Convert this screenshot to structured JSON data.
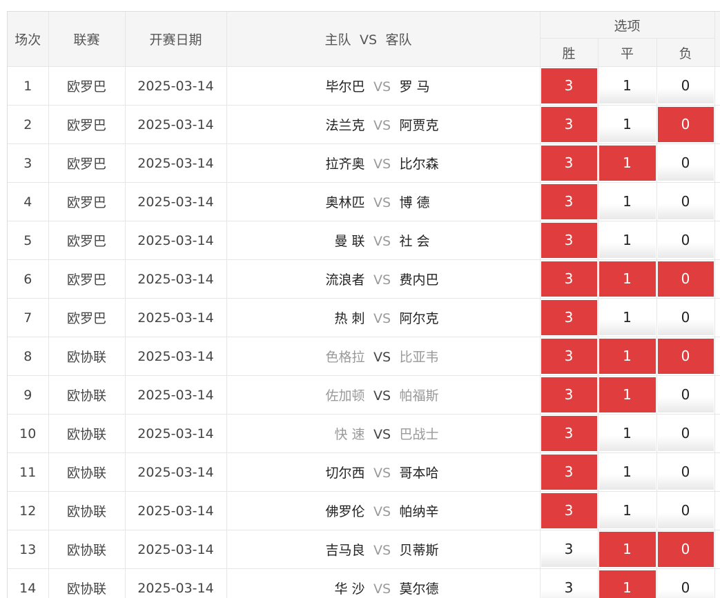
{
  "headers": {
    "round": "场次",
    "league": "联赛",
    "date": "开赛日期",
    "home": "主队",
    "vs": "VS",
    "away": "客队",
    "options": "选项",
    "win": "胜",
    "draw": "平",
    "loss": "负"
  },
  "colors": {
    "selected": "#e03e3e",
    "vs": "#999999"
  },
  "rows": [
    {
      "no": "1",
      "league": "欧罗巴",
      "date": "2025-03-14",
      "home": "毕尔巴",
      "vs": "VS",
      "away": "罗 马",
      "gray": false,
      "win": "3",
      "draw": "1",
      "loss": "0",
      "sel": [
        true,
        false,
        false
      ]
    },
    {
      "no": "2",
      "league": "欧罗巴",
      "date": "2025-03-14",
      "home": "法兰克",
      "vs": "VS",
      "away": "阿贾克",
      "gray": false,
      "win": "3",
      "draw": "1",
      "loss": "0",
      "sel": [
        true,
        false,
        true
      ]
    },
    {
      "no": "3",
      "league": "欧罗巴",
      "date": "2025-03-14",
      "home": "拉齐奥",
      "vs": "VS",
      "away": "比尔森",
      "gray": false,
      "win": "3",
      "draw": "1",
      "loss": "0",
      "sel": [
        true,
        true,
        false
      ]
    },
    {
      "no": "4",
      "league": "欧罗巴",
      "date": "2025-03-14",
      "home": "奥林匹",
      "vs": "VS",
      "away": "博 德",
      "gray": false,
      "win": "3",
      "draw": "1",
      "loss": "0",
      "sel": [
        true,
        false,
        false
      ]
    },
    {
      "no": "5",
      "league": "欧罗巴",
      "date": "2025-03-14",
      "home": "曼 联",
      "vs": "VS",
      "away": "社 会",
      "gray": false,
      "win": "3",
      "draw": "1",
      "loss": "0",
      "sel": [
        true,
        false,
        false
      ]
    },
    {
      "no": "6",
      "league": "欧罗巴",
      "date": "2025-03-14",
      "home": "流浪者",
      "vs": "VS",
      "away": "费内巴",
      "gray": false,
      "win": "3",
      "draw": "1",
      "loss": "0",
      "sel": [
        true,
        true,
        true
      ]
    },
    {
      "no": "7",
      "league": "欧罗巴",
      "date": "2025-03-14",
      "home": "热 刺",
      "vs": "VS",
      "away": "阿尔克",
      "gray": false,
      "win": "3",
      "draw": "1",
      "loss": "0",
      "sel": [
        true,
        false,
        false
      ]
    },
    {
      "no": "8",
      "league": "欧协联",
      "date": "2025-03-14",
      "home": "色格拉",
      "vs": "VS",
      "away": "比亚韦",
      "gray": true,
      "win": "3",
      "draw": "1",
      "loss": "0",
      "sel": [
        true,
        true,
        true
      ]
    },
    {
      "no": "9",
      "league": "欧协联",
      "date": "2025-03-14",
      "home": "佐加顿",
      "vs": "VS",
      "away": "帕福斯",
      "gray": true,
      "win": "3",
      "draw": "1",
      "loss": "0",
      "sel": [
        true,
        true,
        false
      ]
    },
    {
      "no": "10",
      "league": "欧协联",
      "date": "2025-03-14",
      "home": "快 速",
      "vs": "VS",
      "away": "巴战士",
      "gray": true,
      "win": "3",
      "draw": "1",
      "loss": "0",
      "sel": [
        true,
        false,
        false
      ]
    },
    {
      "no": "11",
      "league": "欧协联",
      "date": "2025-03-14",
      "home": "切尔西",
      "vs": "VS",
      "away": "哥本哈",
      "gray": false,
      "win": "3",
      "draw": "1",
      "loss": "0",
      "sel": [
        true,
        false,
        false
      ]
    },
    {
      "no": "12",
      "league": "欧协联",
      "date": "2025-03-14",
      "home": "佛罗伦",
      "vs": "VS",
      "away": "帕纳辛",
      "gray": false,
      "win": "3",
      "draw": "1",
      "loss": "0",
      "sel": [
        true,
        false,
        false
      ]
    },
    {
      "no": "13",
      "league": "欧协联",
      "date": "2025-03-14",
      "home": "吉马良",
      "vs": "VS",
      "away": "贝蒂斯",
      "gray": false,
      "win": "3",
      "draw": "1",
      "loss": "0",
      "sel": [
        false,
        true,
        true
      ]
    },
    {
      "no": "14",
      "league": "欧协联",
      "date": "2025-03-14",
      "home": "华 沙",
      "vs": "VS",
      "away": "莫尔德",
      "gray": false,
      "win": "3",
      "draw": "1",
      "loss": "0",
      "sel": [
        false,
        true,
        false
      ]
    }
  ]
}
